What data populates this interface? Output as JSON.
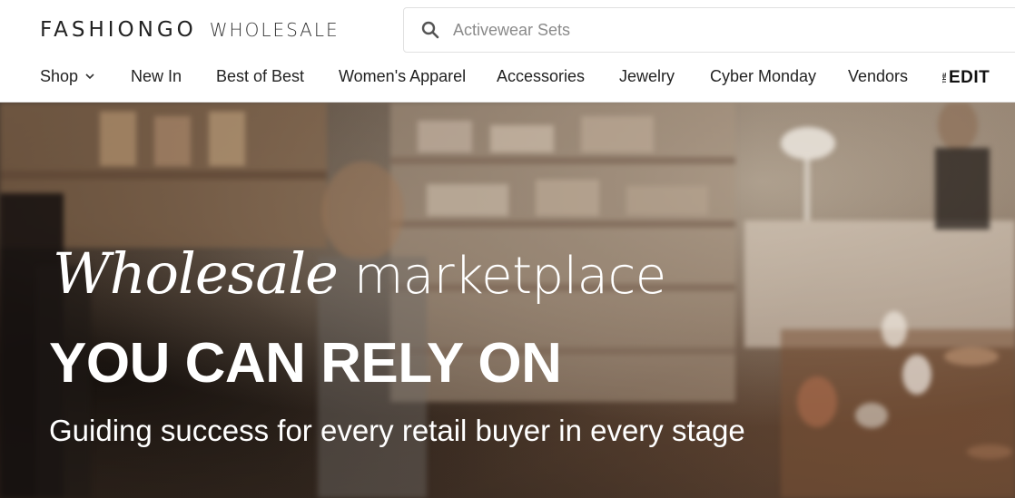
{
  "header": {
    "logo_brand": "FASHIONGO",
    "logo_sub": "WHOLESALE",
    "search": {
      "placeholder": "Activewear Sets",
      "icon": "search-icon"
    }
  },
  "nav": {
    "items": [
      {
        "label": "Shop",
        "has_dropdown": true
      },
      {
        "label": "New In"
      },
      {
        "label": "Best of Best"
      },
      {
        "label": "Women's Apparel"
      },
      {
        "label": "Accessories"
      },
      {
        "label": "Jewelry"
      },
      {
        "label": "Cyber Monday"
      },
      {
        "label": "Vendors"
      }
    ],
    "edit_logo": {
      "small": "THE",
      "word": "EDIT"
    }
  },
  "hero": {
    "script_word": "Wholesale",
    "rest_word": "marketplace",
    "headline": "YOU CAN RELY ON",
    "subtitle": "Guiding success for every retail buyer in every stage"
  }
}
